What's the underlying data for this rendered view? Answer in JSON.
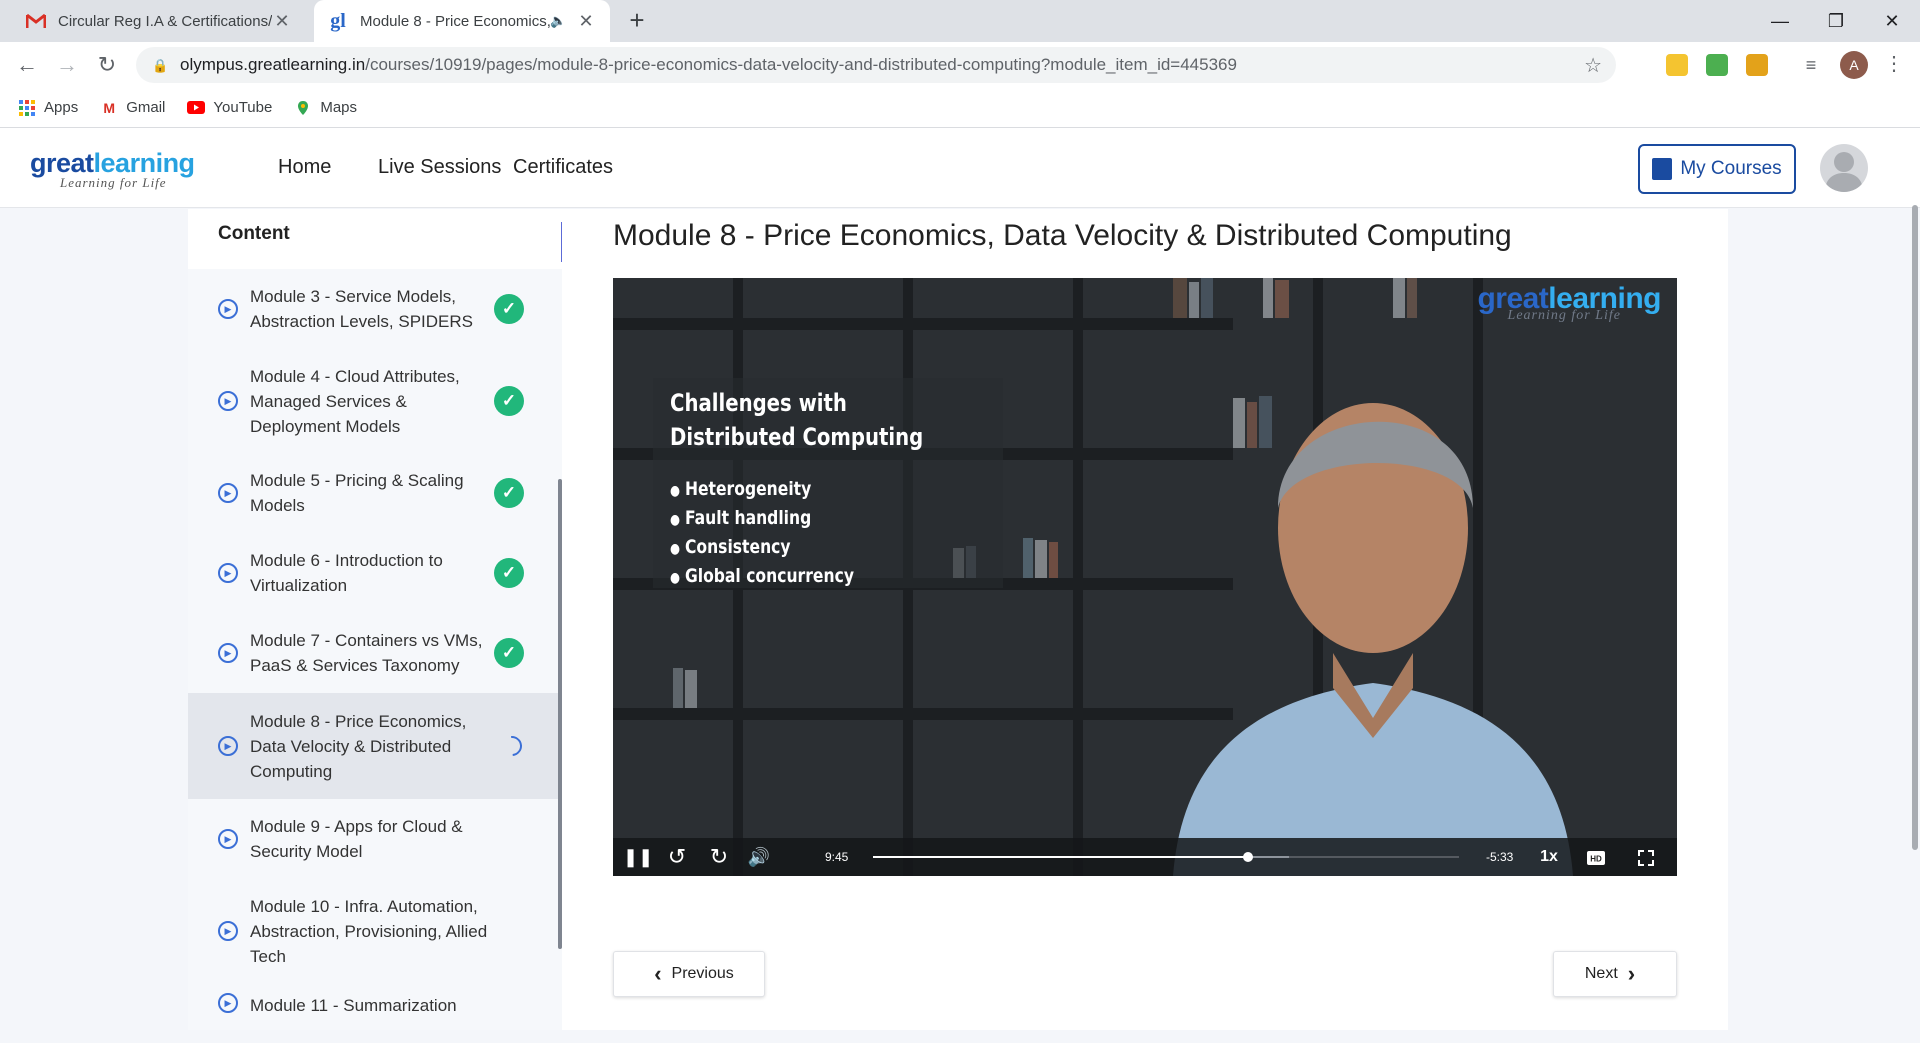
{
  "browser": {
    "tabs": [
      {
        "title": "Circular Reg I.A & Certifications/",
        "favicon": "gmail-icon"
      },
      {
        "title": "Module 8 - Price Economics,",
        "favicon": "greatlearning-icon",
        "audio": true
      }
    ],
    "url_host": "olympus.greatlearning.in",
    "url_path": "/courses/10919/pages/module-8-price-economics-data-velocity-and-distributed-computing?module_item_id=445369",
    "profile_initial": "A",
    "bookmarks": [
      {
        "label": "Apps",
        "icon": "apps-grid-icon"
      },
      {
        "label": "Gmail",
        "icon": "gmail-icon"
      },
      {
        "label": "YouTube",
        "icon": "youtube-icon"
      },
      {
        "label": "Maps",
        "icon": "maps-icon"
      }
    ]
  },
  "site": {
    "logo_great": "great",
    "logo_learning": "learning",
    "logo_tagline": "Learning for Life",
    "nav": [
      "Home",
      "Live Sessions",
      "Certificates"
    ],
    "my_courses": "My Courses",
    "accent": "#1a4ba0"
  },
  "sidebar": {
    "heading": "Content",
    "modules": [
      {
        "title": "Module 3 - Service Models, Abstraction Levels, SPIDERS",
        "status": "done"
      },
      {
        "title": "Module 4 - Cloud Attributes, Managed Services & Deployment Models",
        "status": "done"
      },
      {
        "title": "Module 5 - Pricing & Scaling Models",
        "status": "done"
      },
      {
        "title": "Module 6 - Introduction to Virtualization",
        "status": "done"
      },
      {
        "title": "Module 7 - Containers vs VMs, PaaS & Services Taxonomy",
        "status": "done"
      },
      {
        "title": "Module 8 - Price Economics, Data Velocity & Distributed Computing",
        "status": "in-progress"
      },
      {
        "title": "Module 9 - Apps for Cloud & Security Model",
        "status": "none"
      },
      {
        "title": "Module 10 - Infra. Automation, Abstraction, Provisioning, Allied Tech",
        "status": "none"
      },
      {
        "title": "Module 11 - Summarization",
        "status": "none"
      }
    ],
    "done_color": "#21b77b"
  },
  "main": {
    "title": "Module 8 - Price Economics, Data Velocity & Distributed Computing",
    "video": {
      "watermark": "greatlearning",
      "watermark_tagline": "Learning for Life",
      "slide_title": "Challenges with Distributed Computing",
      "slide_bullets": [
        "Heterogeneity",
        "Fault handling",
        "Consistency",
        "Global concurrency"
      ],
      "elapsed": "9:45",
      "remaining": "-5:33",
      "speed": "1x",
      "progress_fraction": 0.64,
      "buffered_fraction": 0.71
    },
    "previous_label": "Previous",
    "next_label": "Next"
  }
}
